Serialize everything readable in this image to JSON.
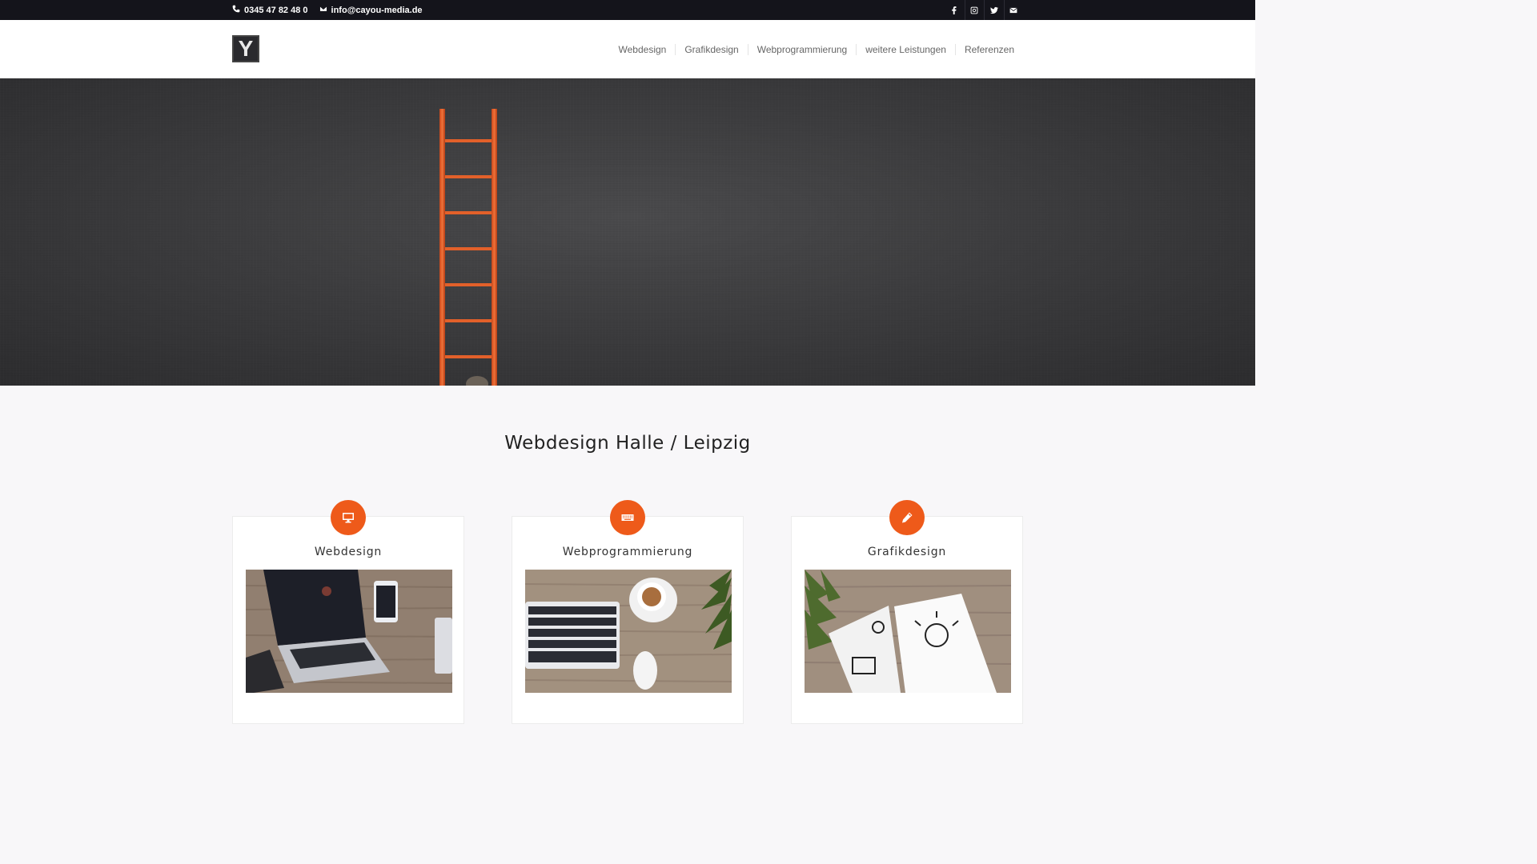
{
  "topbar": {
    "phone": "0345 47 82 48 0",
    "email": "info@cayou-media.de",
    "social": [
      "facebook-icon",
      "instagram-icon",
      "twitter-icon",
      "mail-icon"
    ]
  },
  "header": {
    "logo_letter": "Y",
    "nav": [
      "Webdesign",
      "Grafikdesign",
      "Webprogrammierung",
      "weitere Leistungen",
      "Referenzen"
    ]
  },
  "hero": {
    "accent": "#e25a22"
  },
  "intro": {
    "title": "Webdesign Halle / Leipzig"
  },
  "cards": [
    {
      "title": "Webdesign",
      "icon": "monitor-icon"
    },
    {
      "title": "Webprogrammierung",
      "icon": "keyboard-icon"
    },
    {
      "title": "Grafikdesign",
      "icon": "pencil-icon"
    }
  ],
  "colors": {
    "accent": "#ee5a1a",
    "topbar": "#14141b"
  }
}
